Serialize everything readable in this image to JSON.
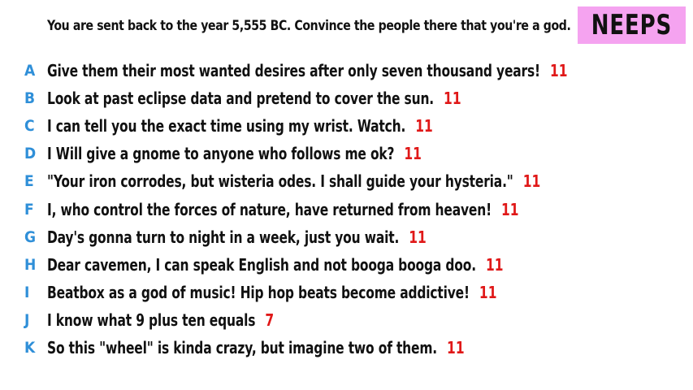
{
  "prompt": "You are sent back to the year 5,555 BC. Convince the people there that you're a god.",
  "player": "NEEPS",
  "colors": {
    "badge": "#f5a3f0",
    "letter": "#2f8fd8",
    "score": "#e01818"
  },
  "answers": [
    {
      "letter": "A",
      "text": "Give them their most wanted desires after only seven thousand years!",
      "score": "11"
    },
    {
      "letter": "B",
      "text": "Look at past eclipse data and pretend to cover the sun.",
      "score": "11"
    },
    {
      "letter": "C",
      "text": "I can tell you the exact time using my wrist. Watch.",
      "score": "11"
    },
    {
      "letter": "D",
      "text": "I Will give a gnome to anyone who follows me ok?",
      "score": "11"
    },
    {
      "letter": "E",
      "text": "\"Your iron corrodes, but wisteria odes. I shall guide your hysteria.\"",
      "score": "11"
    },
    {
      "letter": "F",
      "text": "I, who control the forces of nature, have returned from heaven!",
      "score": "11"
    },
    {
      "letter": "G",
      "text": "Day's gonna turn to night in a week, just you wait.",
      "score": "11"
    },
    {
      "letter": "H",
      "text": "Dear cavemen, I can speak English and not booga booga doo.",
      "score": "11"
    },
    {
      "letter": "I",
      "text": "Beatbox as a god of music! Hip hop beats become addictive!",
      "score": "11"
    },
    {
      "letter": "J",
      "text": "I know what 9 plus ten equals",
      "score": "7"
    },
    {
      "letter": "K",
      "text": "So this \"wheel\" is kinda crazy, but imagine two of them.",
      "score": "11"
    }
  ]
}
